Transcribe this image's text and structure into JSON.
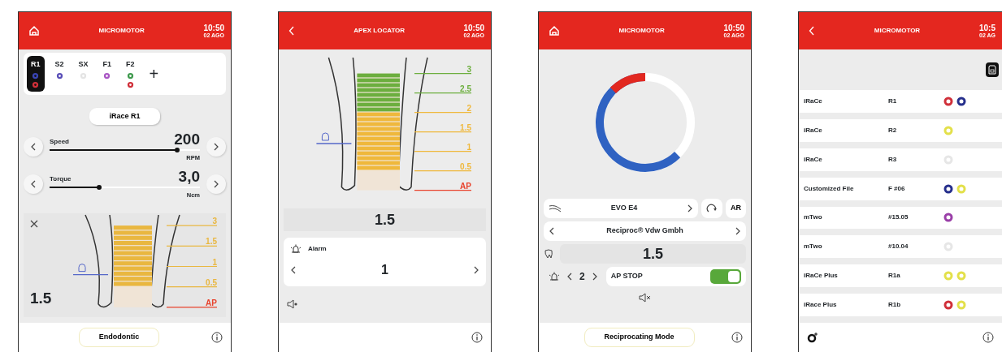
{
  "screens": [
    {
      "kind": "micromotor",
      "header": {
        "kind": "home",
        "title": "MICROMOTOR",
        "time": "10:50",
        "date": "02 AGO"
      },
      "files": [
        {
          "label": "R1",
          "selected": true,
          "rings": [
            {
              "color": "#3a45b5"
            },
            {
              "color": "#d0303a"
            }
          ]
        },
        {
          "label": "S2",
          "selected": false,
          "rings": [
            {
              "color": "#5a4fb8"
            }
          ]
        },
        {
          "label": "SX",
          "selected": false,
          "rings": [
            {
              "color": "#e4e4e4"
            }
          ]
        },
        {
          "label": "F1",
          "selected": false,
          "rings": [
            {
              "color": "#a957c4"
            }
          ]
        },
        {
          "label": "F2",
          "selected": false,
          "rings": [
            {
              "color": "#3f9a4e"
            },
            {
              "color": "#d0303a"
            }
          ]
        }
      ],
      "add": "+",
      "file_name": "iRace R1",
      "sliders": [
        {
          "label": "Speed",
          "value": "200",
          "unit": "RPM",
          "level": 0.85
        },
        {
          "label": "Torque",
          "value": "3,0",
          "unit": "Ncm",
          "level": 0.33
        }
      ],
      "apex": {
        "reading": "1.5",
        "scale": [
          {
            "label": "3",
            "color": "#e9b740"
          },
          {
            "label": "1.5",
            "color": "#e9b740"
          },
          {
            "label": "1",
            "color": "#e9b740"
          },
          {
            "label": "0.5",
            "color": "#e9b740"
          },
          {
            "label": "AP",
            "color": "#e8432d"
          }
        ]
      },
      "footer": {
        "mode": "Endodontic"
      }
    },
    {
      "kind": "apex",
      "header": {
        "kind": "back",
        "title": "APEX LOCATOR",
        "time": "10:50",
        "date": "02 AGO"
      },
      "apex": {
        "reading": "1.5",
        "scale": [
          {
            "label": "3",
            "color": "#6cae3e"
          },
          {
            "label": "2.5",
            "color": "#6cae3e"
          },
          {
            "label": "2",
            "color": "#efb83c"
          },
          {
            "label": "1.5",
            "color": "#efb83c"
          },
          {
            "label": "1",
            "color": "#efb83c"
          },
          {
            "label": "0.5",
            "color": "#efb83c"
          },
          {
            "label": "AP",
            "color": "#e8432d"
          }
        ]
      },
      "alarm": {
        "label": "Alarm",
        "value": "1"
      },
      "muted": false
    },
    {
      "kind": "motor",
      "header": {
        "kind": "home",
        "title": "MICROMOTOR",
        "time": "10:50",
        "date": "02 AGO"
      },
      "file": "EVO E4",
      "direction": "AR",
      "brand": "Reciproc® Vdw Gmbh",
      "reading": "1.5",
      "alarm": "2",
      "ap_stop": {
        "label": "AP STOP",
        "on": true
      },
      "muted": true,
      "footer": {
        "mode": "Reciprocating Mode"
      }
    },
    {
      "kind": "list",
      "header": {
        "kind": "back",
        "title": "MICROMOTOR",
        "time": "10:5",
        "date": "02 AG"
      },
      "rows": [
        {
          "name": "iRaCe",
          "size": "R1",
          "rings": [
            {
              "color": "#d0303a"
            },
            {
              "color": "#262f8c"
            }
          ]
        },
        {
          "name": "iRaCe",
          "size": "R2",
          "rings": [
            {
              "color": "#e3e04a"
            }
          ]
        },
        {
          "name": "iRaCe",
          "size": "R3",
          "rings": [
            {
              "color": "#e6e6e6"
            }
          ]
        },
        {
          "name": "Customized File",
          "size": "F #06",
          "rings": [
            {
              "color": "#262f8c"
            },
            {
              "color": "#e3e04a"
            }
          ]
        },
        {
          "name": "mTwo",
          "size": "#15.05",
          "rings": [
            {
              "color": "#9a3fa8"
            }
          ]
        },
        {
          "name": "mTwo",
          "size": "#10.04",
          "rings": [
            {
              "color": "#e6e6e6"
            }
          ]
        },
        {
          "name": "iRaCe Plus",
          "size": "R1a",
          "rings": [
            {
              "color": "#e3e04a"
            },
            {
              "color": "#e3e04a"
            }
          ]
        },
        {
          "name": "iRace Plus",
          "size": "R1b",
          "rings": [
            {
              "color": "#d0303a"
            },
            {
              "color": "#e3e04a"
            }
          ]
        }
      ]
    }
  ]
}
